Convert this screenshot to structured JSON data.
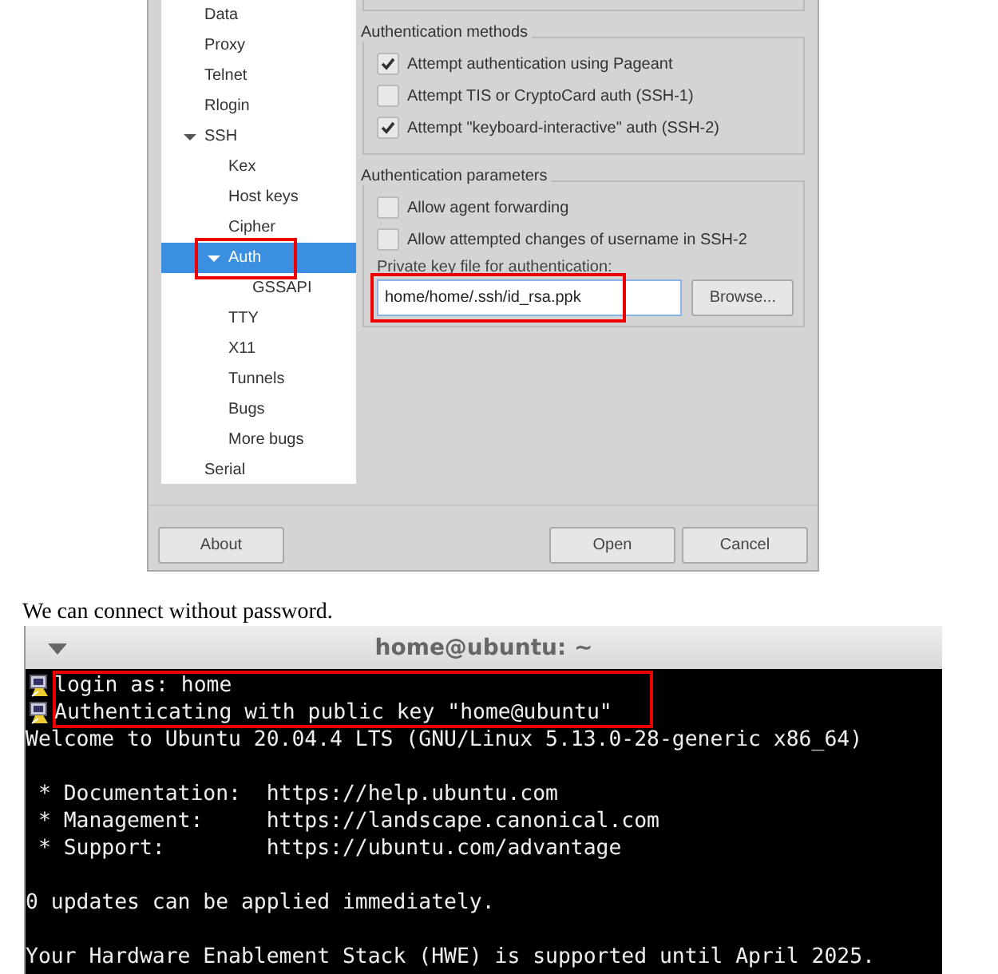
{
  "dialog": {
    "tree": [
      {
        "label": "Data",
        "selected": false
      },
      {
        "label": "Proxy",
        "selected": false
      },
      {
        "label": "Telnet",
        "selected": false
      },
      {
        "label": "Rlogin",
        "selected": false
      },
      {
        "label": "SSH",
        "selected": false,
        "expanded": true,
        "children": [
          {
            "label": "Kex",
            "selected": false
          },
          {
            "label": "Host keys",
            "selected": false
          },
          {
            "label": "Cipher",
            "selected": false
          },
          {
            "label": "Auth",
            "selected": true,
            "highlighted": true,
            "expanded": true,
            "children": [
              {
                "label": "GSSAPI",
                "selected": false
              }
            ]
          },
          {
            "label": "TTY",
            "selected": false
          },
          {
            "label": "X11",
            "selected": false
          },
          {
            "label": "Tunnels",
            "selected": false
          },
          {
            "label": "Bugs",
            "selected": false
          },
          {
            "label": "More bugs",
            "selected": false
          }
        ]
      },
      {
        "label": "Serial",
        "selected": false
      }
    ],
    "groups": [
      {
        "title": "Authentication methods",
        "checkboxes": [
          {
            "label": "Attempt authentication using Pageant",
            "checked": true
          },
          {
            "label": "Attempt TIS or CryptoCard auth (SSH-1)",
            "checked": false
          },
          {
            "label": "Attempt \"keyboard-interactive\" auth (SSH-2)",
            "checked": true
          }
        ]
      },
      {
        "title": "Authentication parameters",
        "checkboxes": [
          {
            "label": "Allow agent forwarding",
            "checked": false
          },
          {
            "label": "Allow attempted changes of username in SSH-2",
            "checked": false
          }
        ],
        "key_file": {
          "label": "Private key file for authentication:",
          "value": "home/home/.ssh/id_rsa.ppk",
          "highlighted": true,
          "button": "Browse..."
        }
      }
    ],
    "buttons": {
      "left": [
        "About"
      ],
      "right": [
        "Open",
        "Cancel"
      ]
    }
  },
  "caption": "We can connect without password.",
  "terminal": {
    "title": "home@ubuntu: ~",
    "lines": [
      {
        "kind": "icon",
        "text": "login as: home",
        "highlighted": true
      },
      {
        "kind": "icon",
        "text": "Authenticating with public key \"home@ubuntu\"",
        "highlighted": true
      },
      {
        "kind": "plain",
        "text": "Welcome to Ubuntu 20.04.4 LTS (GNU/Linux 5.13.0-28-generic x86_64)"
      },
      {
        "kind": "blank"
      },
      {
        "kind": "plain",
        "text": " * Documentation:  https://help.ubuntu.com"
      },
      {
        "kind": "plain",
        "text": " * Management:     https://landscape.canonical.com"
      },
      {
        "kind": "plain",
        "text": " * Support:        https://ubuntu.com/advantage"
      },
      {
        "kind": "blank"
      },
      {
        "kind": "plain",
        "text": "0 updates can be applied immediately."
      },
      {
        "kind": "blank"
      },
      {
        "kind": "plain",
        "text": "Your Hardware Enablement Stack (HWE) is supported until April 2025."
      }
    ]
  }
}
